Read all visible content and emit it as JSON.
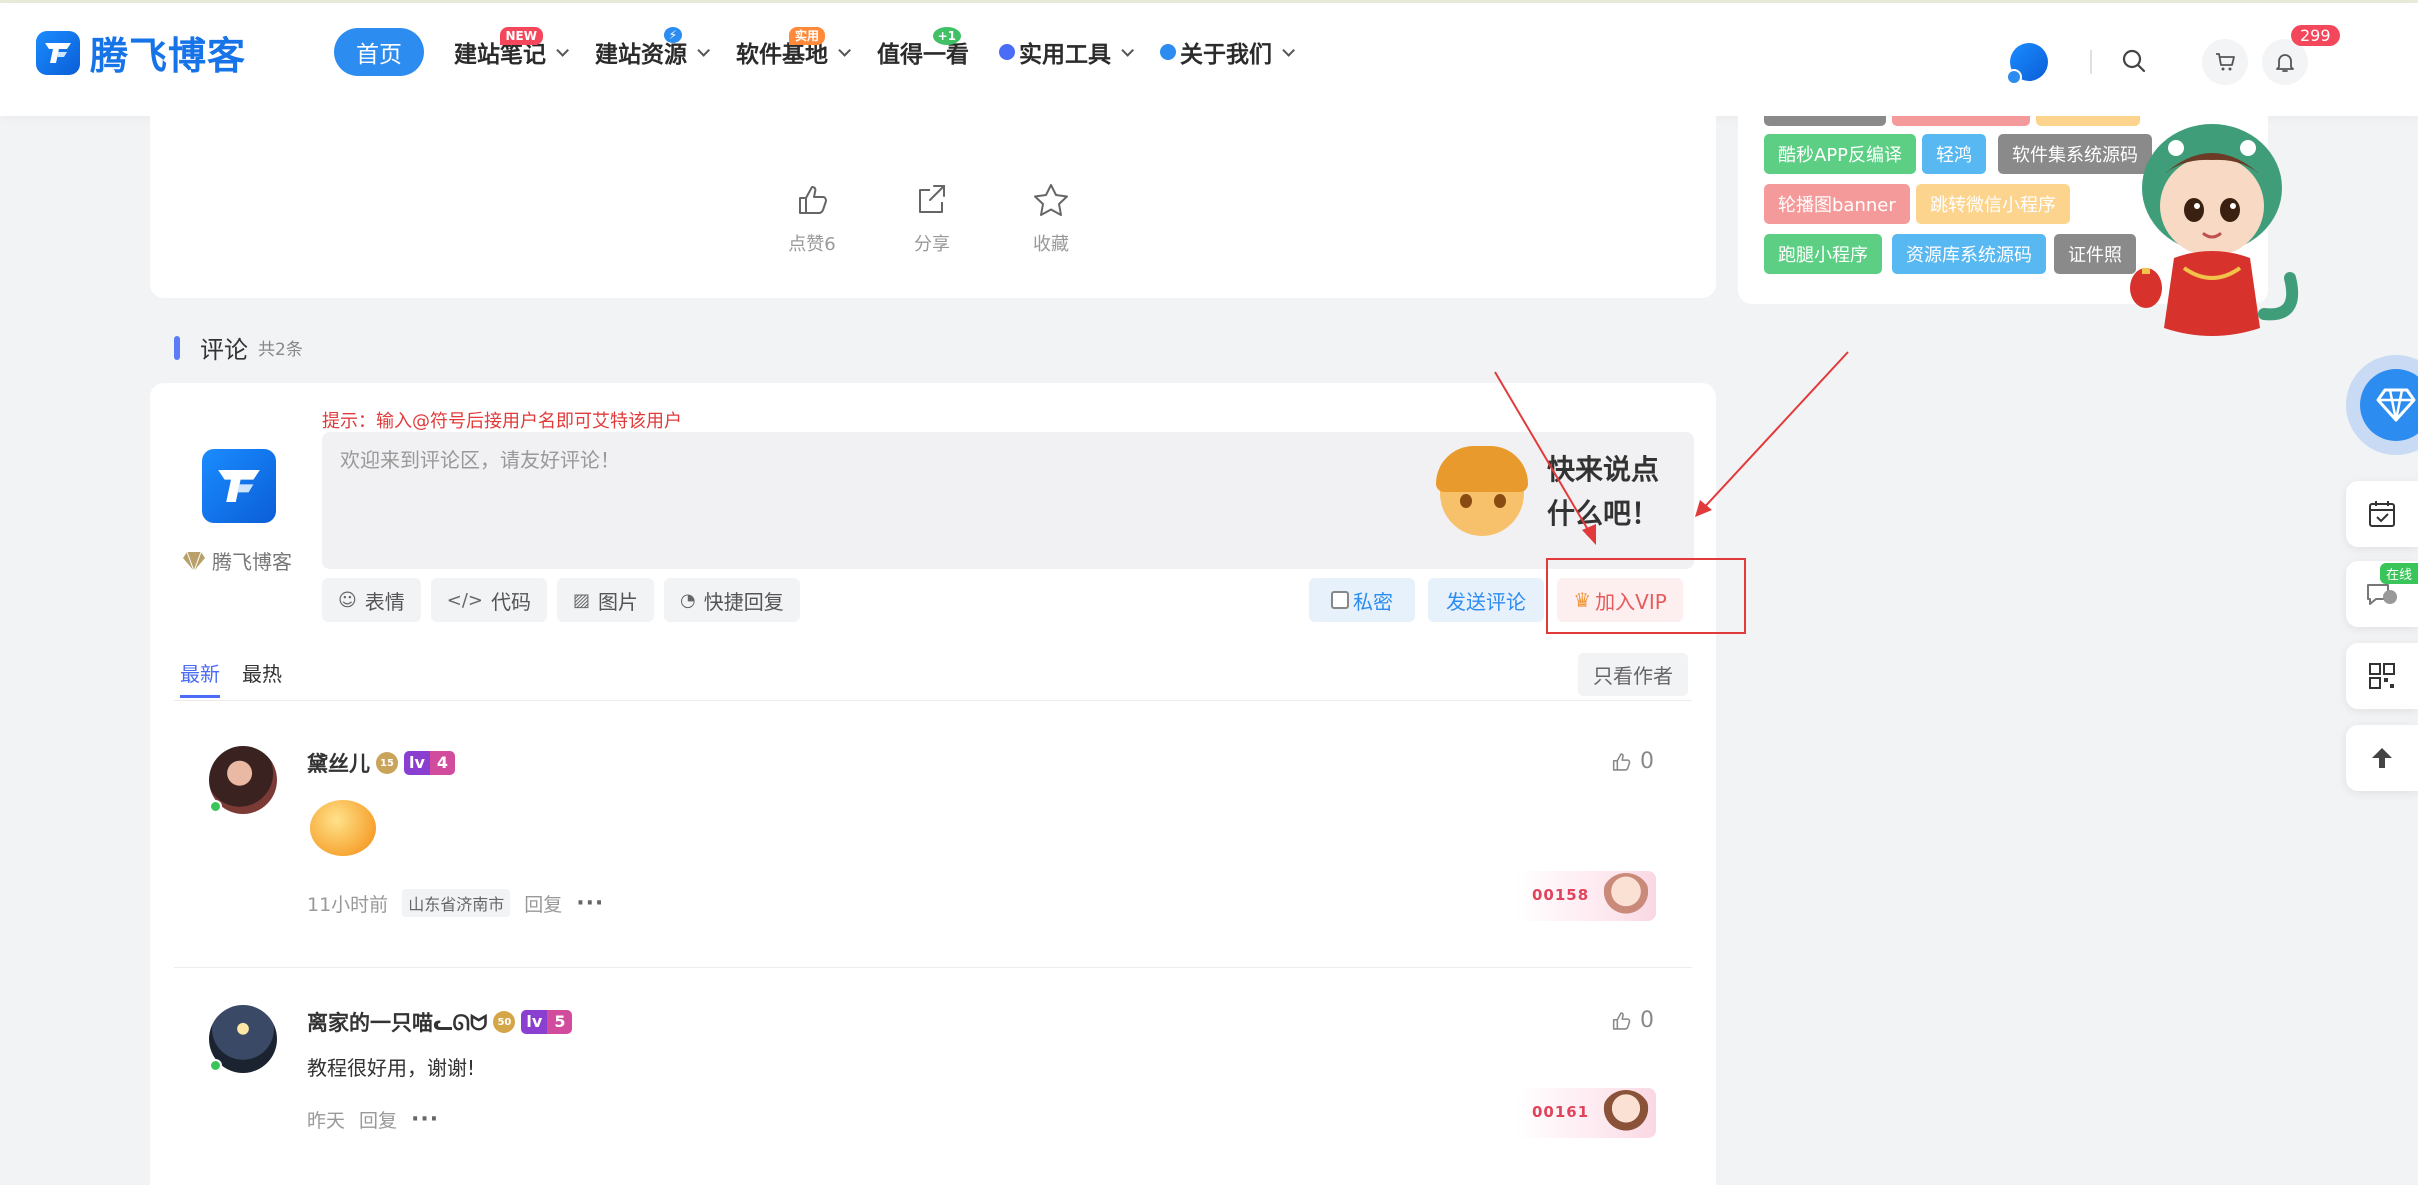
{
  "header": {
    "logo_text": "腾飞博客",
    "nav": [
      {
        "label": "首页",
        "active": true
      },
      {
        "label": "建站笔记",
        "badge": "NEW"
      },
      {
        "label": "建站资源",
        "badge": "⚡"
      },
      {
        "label": "软件基地",
        "badge": "实用"
      },
      {
        "label": "值得一看",
        "badge": "+1"
      },
      {
        "label": "实用工具"
      },
      {
        "label": "关于我们"
      }
    ],
    "notify_count": "299"
  },
  "article_actions": {
    "like_label": "点赞",
    "like_count": "6",
    "share_label": "分享",
    "fav_label": "收藏"
  },
  "comments_section": {
    "title": "评论",
    "count_label": "共2条",
    "tip": "提示：输入@符号后接用户名即可艾特该用户",
    "placeholder": "欢迎来到评论区，请友好评论！",
    "sticker_text_line1": "快来说点",
    "sticker_text_line2": "什么吧！",
    "current_user": "腾飞博客",
    "tools": [
      "表情",
      "代码",
      "图片",
      "快捷回复"
    ],
    "private_label": "私密",
    "send_label": "发送评论",
    "vip_label": "加入VIP",
    "sort_latest": "最新",
    "sort_hot": "最热",
    "only_author": "只看作者"
  },
  "comments": [
    {
      "name": "黛丝儿",
      "medal": "15",
      "level": "4",
      "time": "11小时前",
      "location": "山东省济南市",
      "reply_label": "回复",
      "likes": "0",
      "card_no": "00158"
    },
    {
      "name": "离家的一只喵ᓚᘏᗢ",
      "medal": "50",
      "level": "5",
      "text": "教程很好用，谢谢!",
      "time": "昨天",
      "reply_label": "回复",
      "likes": "0",
      "card_no": "00161"
    }
  ],
  "sidebar_tags": [
    "酷秒APP反编译",
    "轻鸿",
    "软件集系统源码",
    "轮播图banner",
    "跳转微信小程序",
    "跑腿小程序",
    "资源库系统源码",
    "证件照"
  ],
  "float_bar": {
    "online_label": "在线"
  }
}
